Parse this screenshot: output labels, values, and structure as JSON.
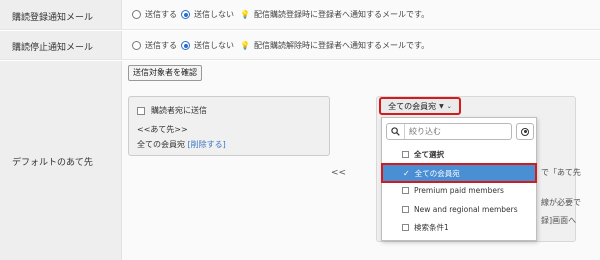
{
  "rows": {
    "subscribe_mail": {
      "label": "購読登録通知メール",
      "option_send": "送信する",
      "option_nosend": "送信しない",
      "note": "配信購読登録時に登録者へ通知するメールです。"
    },
    "unsubscribe_mail": {
      "label": "購読停止通知メール",
      "option_send": "送信する",
      "option_nosend": "送信しない",
      "note": "配信購読解除時に登録者へ通知するメールです。"
    },
    "default_destination": {
      "label": "デフォルトのあて先"
    }
  },
  "confirm_button": "送信対象者を確認",
  "left_box": {
    "subscribers_checkbox": "購読者宛に送信",
    "dest_label": "<<あて先>>",
    "dest_item": "全ての会員宛",
    "remove_link": "[削除する]"
  },
  "move_left_arrow": "<<",
  "background_text": {
    "line1": "で「あて先",
    "line2": "線が必要で",
    "line3": "録]画面へ"
  },
  "dropdown": {
    "button_label": "全ての会員宛",
    "search_placeholder": "絞り込む",
    "options": [
      {
        "label": "全て選択",
        "type": "checkbox",
        "bold": true
      },
      {
        "label": "全ての会員宛",
        "type": "check",
        "selected": true
      },
      {
        "label": "Premium paid members",
        "type": "checkbox"
      },
      {
        "label": "New and regional members",
        "type": "checkbox"
      },
      {
        "label": "検索条件1",
        "type": "checkbox"
      }
    ]
  },
  "icons": {
    "search": "search-icon",
    "clear": "clear-icon",
    "caret": "caret-down-icon",
    "bulb": "lightbulb-icon"
  },
  "colors": {
    "accent_blue": "#2b6ecf",
    "highlight_red": "#d31b1b",
    "selected_bg": "#4a8fd4",
    "label_bg": "#eeeeee"
  }
}
